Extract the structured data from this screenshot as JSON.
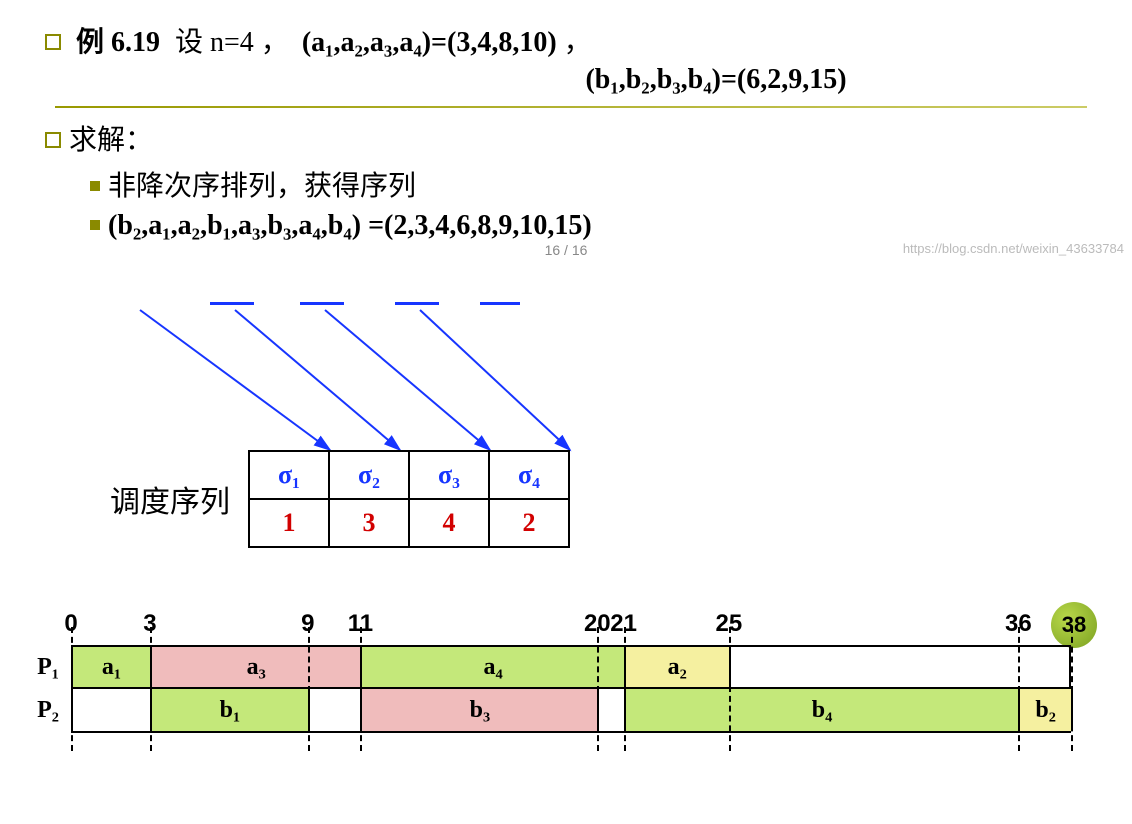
{
  "problem": {
    "example_label": "例 6.19",
    "setup": "设 n=4 ，",
    "a_vector": "(a₁,a₂,a₃,a₄)=(3,4,8,10)",
    "comma": "，",
    "b_vector": "(b₁,b₂,b₃,b₄)=(6,2,9,15)"
  },
  "solve_label": "求解：",
  "nondesc_text": "非降次序排列，获得序列",
  "sorted_seq": "(b₂,a₁,a₂,b₁,a₃,b₃,a₄,b₄) =(2,3,4,6,8,9,10,15)",
  "schedule": {
    "label": "调度序列",
    "sigmas": [
      "σ₁",
      "σ₂",
      "σ₃",
      "σ₄"
    ],
    "values": [
      "1",
      "3",
      "4",
      "2"
    ]
  },
  "chart_data": {
    "type": "gantt",
    "time_axis": [
      0,
      3,
      9,
      11,
      20,
      21,
      25,
      36,
      38
    ],
    "total": 38,
    "rows": [
      {
        "label": "P₁",
        "bars": [
          {
            "name": "a₁",
            "start": 0,
            "end": 3,
            "color": "g-green"
          },
          {
            "name": "a₃",
            "start": 3,
            "end": 11,
            "color": "g-pink"
          },
          {
            "name": "a₄",
            "start": 11,
            "end": 21,
            "color": "g-green"
          },
          {
            "name": "a₂",
            "start": 21,
            "end": 25,
            "color": "g-yellow"
          }
        ]
      },
      {
        "label": "P₂",
        "bars": [
          {
            "name": "",
            "start": 0,
            "end": 3,
            "color": "g-white"
          },
          {
            "name": "b₁",
            "start": 3,
            "end": 9,
            "color": "g-green"
          },
          {
            "name": "",
            "start": 9,
            "end": 11,
            "color": "g-white"
          },
          {
            "name": "b₃",
            "start": 11,
            "end": 20,
            "color": "g-pink"
          },
          {
            "name": "",
            "start": 20,
            "end": 21,
            "color": "g-white"
          },
          {
            "name": "b₄",
            "start": 21,
            "end": 36,
            "color": "g-green"
          },
          {
            "name": "b₂",
            "start": 36,
            "end": 38,
            "color": "g-yellow"
          }
        ]
      }
    ]
  },
  "page": "16 / 16",
  "watermark": "https://blog.csdn.net/weixin_43633784"
}
